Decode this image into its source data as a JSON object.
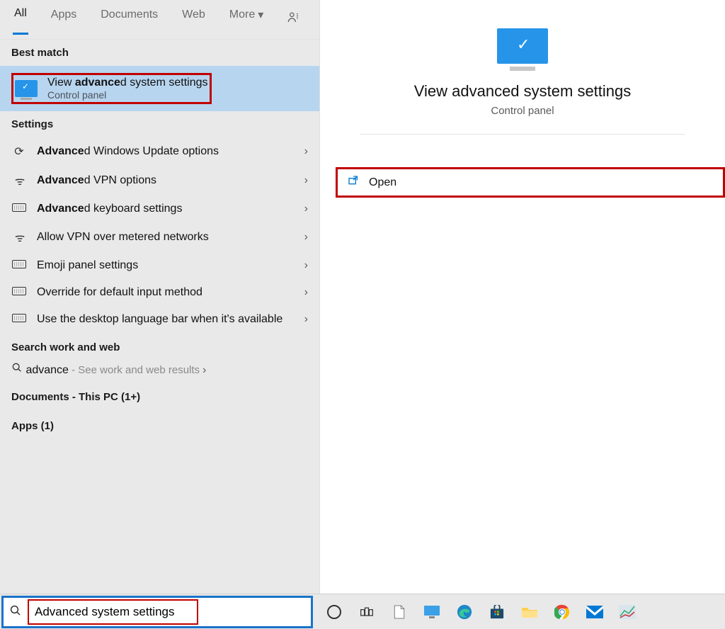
{
  "tabs": {
    "all": "All",
    "apps": "Apps",
    "documents": "Documents",
    "web": "Web",
    "more": "More"
  },
  "sections": {
    "best_match": "Best match",
    "settings": "Settings",
    "search_work_web": "Search work and web",
    "documents_this_pc": "Documents - This PC (1+)",
    "apps_1": "Apps (1)"
  },
  "best_match": {
    "title_plain_before": "View ",
    "title_bold": "advance",
    "title_plain_after": "d system settings",
    "subtitle": "Control panel"
  },
  "settings_items": [
    {
      "icon": "refresh",
      "bold": "Advance",
      "rest": "d Windows Update options"
    },
    {
      "icon": "vpn",
      "bold": "Advance",
      "rest": "d VPN options"
    },
    {
      "icon": "keyboard",
      "bold": "Advance",
      "rest": "d keyboard settings"
    },
    {
      "icon": "vpn",
      "bold": "",
      "rest": "Allow VPN over metered networks"
    },
    {
      "icon": "keyboard",
      "bold": "",
      "rest": "Emoji panel settings"
    },
    {
      "icon": "keyboard",
      "bold": "",
      "rest": "Override for default input method"
    },
    {
      "icon": "keyboard",
      "bold": "",
      "rest": "Use the desktop language bar when it's available"
    }
  ],
  "web_result": {
    "term": "advance",
    "hint": " - See work and web results"
  },
  "preview": {
    "title": "View advanced system settings",
    "subtitle": "Control panel",
    "open": "Open"
  },
  "search_input": "Advanced system settings"
}
